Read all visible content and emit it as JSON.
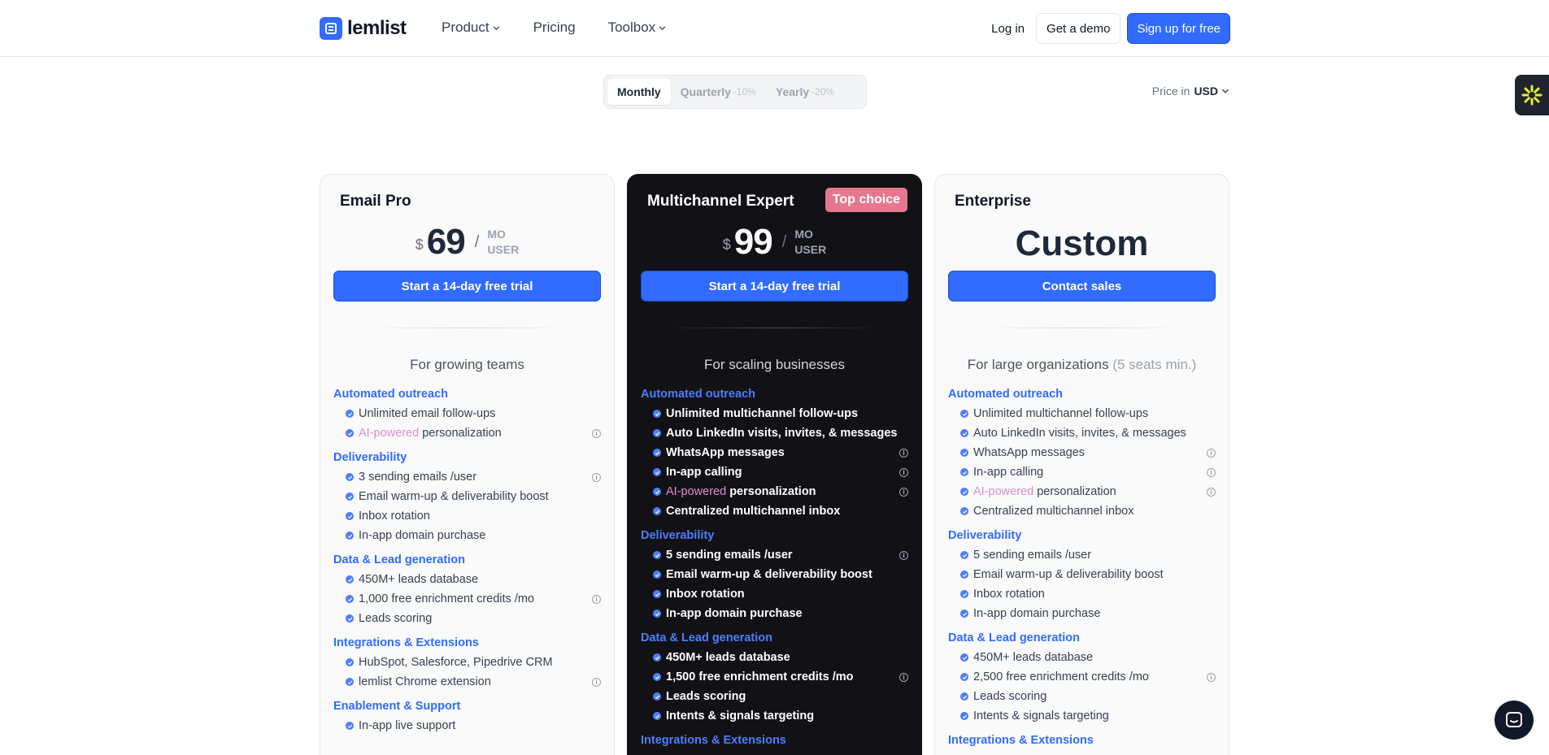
{
  "header": {
    "logo_text": "lemlist",
    "nav": [
      "Product",
      "Pricing",
      "Toolbox"
    ],
    "login": "Log in",
    "demo": "Get a demo",
    "signup": "Sign up for free"
  },
  "billing": {
    "monthly": "Monthly",
    "quarterly": "Quarterly",
    "quarterly_discount": "-10%",
    "yearly": "Yearly",
    "yearly_discount": "-20%",
    "price_in": "Price in",
    "currency": "USD"
  },
  "plans": {
    "pro": {
      "title": "Email Pro",
      "currency_symbol": "$",
      "price": "69",
      "slash": "/",
      "unit_1": "MO",
      "unit_2": "USER",
      "cta": "Start a 14-day free trial",
      "for": "For growing teams",
      "sections": [
        {
          "title": "Automated outreach",
          "items": [
            "Unlimited email follow-ups",
            "personalization"
          ]
        },
        {
          "title": "Deliverability",
          "items": [
            "3 sending emails /user",
            "Email warm-up & deliverability boost",
            "Inbox rotation",
            "In-app domain purchase"
          ]
        },
        {
          "title": "Data & Lead generation",
          "items": [
            "450M+ leads database",
            "1,000 free enrichment credits /mo",
            "Leads scoring"
          ]
        },
        {
          "title": "Integrations & Extensions",
          "items": [
            "HubSpot, Salesforce, Pipedrive CRM",
            "lemlist Chrome extension"
          ]
        },
        {
          "title": "Enablement & Support",
          "items": [
            "In-app live support"
          ]
        }
      ]
    },
    "expert": {
      "title": "Multichannel Expert",
      "badge": "Top choice",
      "currency_symbol": "$",
      "price": "99",
      "slash": "/",
      "unit_1": "MO",
      "unit_2": "USER",
      "cta": "Start a 14-day free trial",
      "for": "For scaling businesses",
      "sections": [
        {
          "title": "Automated outreach",
          "items": [
            "Unlimited multichannel follow-ups",
            "Auto LinkedIn visits, invites, & messages",
            "WhatsApp messages",
            "In-app calling",
            "personalization",
            "Centralized multichannel inbox"
          ]
        },
        {
          "title": "Deliverability",
          "items": [
            "5 sending emails /user",
            "Email warm-up & deliverability boost",
            "Inbox rotation",
            "In-app domain purchase"
          ]
        },
        {
          "title": "Data & Lead generation",
          "items": [
            "450M+ leads database",
            "1,500 free enrichment credits /mo",
            "Leads scoring",
            "Intents & signals targeting"
          ]
        },
        {
          "title": "Integrations & Extensions",
          "items": []
        }
      ]
    },
    "enterprise": {
      "title": "Enterprise",
      "price": "Custom",
      "cta": "Contact sales",
      "for": "For large organizations",
      "for_note": "(5 seats min.)",
      "sections": [
        {
          "title": "Automated outreach",
          "items": [
            "Unlimited multichannel follow-ups",
            "Auto LinkedIn visits, invites, & messages",
            "WhatsApp messages",
            "In-app calling",
            "personalization",
            "Centralized multichannel inbox"
          ]
        },
        {
          "title": "Deliverability",
          "items": [
            "5 sending emails /user",
            "Email warm-up & deliverability boost",
            "Inbox rotation",
            "In-app domain purchase"
          ]
        },
        {
          "title": "Data & Lead generation",
          "items": [
            "450M+ leads database",
            "2,500 free enrichment credits /mo",
            "Leads scoring",
            "Intents & signals targeting"
          ]
        },
        {
          "title": "Integrations & Extensions",
          "items": []
        }
      ]
    }
  },
  "ai_prefix": "AI-powered",
  "info_glyph": "i",
  "colors": {
    "brand": "#316bff",
    "badge": "#e7778e",
    "dark_card": "#121216",
    "ai": "#d88fd1"
  }
}
